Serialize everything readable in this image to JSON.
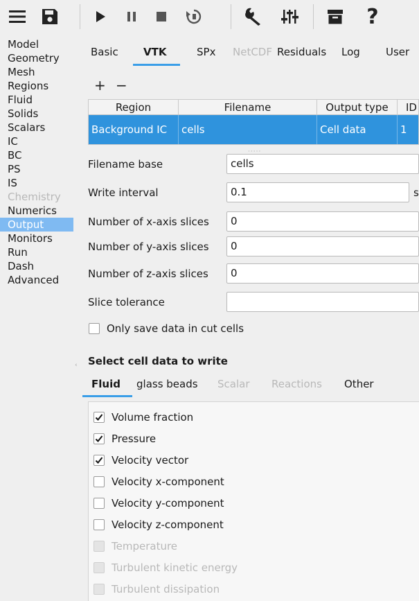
{
  "toolbar": {
    "buttons": [
      {
        "name": "menu-icon"
      },
      {
        "name": "save-icon"
      },
      {
        "name": "play-icon"
      },
      {
        "name": "pause-icon"
      },
      {
        "name": "stop-icon"
      },
      {
        "name": "reset-icon"
      },
      {
        "name": "wrench-icon"
      },
      {
        "name": "sliders-icon"
      },
      {
        "name": "archive-icon"
      },
      {
        "name": "help-icon"
      }
    ]
  },
  "nav": {
    "items": [
      {
        "label": "Model"
      },
      {
        "label": "Geometry"
      },
      {
        "label": "Mesh"
      },
      {
        "label": "Regions"
      },
      {
        "label": "Fluid"
      },
      {
        "label": "Solids"
      },
      {
        "label": "Scalars"
      },
      {
        "label": "IC"
      },
      {
        "label": "BC"
      },
      {
        "label": "PS"
      },
      {
        "label": "IS"
      },
      {
        "label": "Chemistry",
        "disabled": true
      },
      {
        "label": "Numerics"
      },
      {
        "label": "Output",
        "selected": true
      },
      {
        "label": "Monitors"
      },
      {
        "label": "Run"
      },
      {
        "label": "Dash"
      },
      {
        "label": "Advanced"
      }
    ]
  },
  "tabs": [
    {
      "label": "Basic"
    },
    {
      "label": "VTK",
      "active": true
    },
    {
      "label": "SPx"
    },
    {
      "label": "NetCDF",
      "disabled": true
    },
    {
      "label": "Residuals"
    },
    {
      "label": "Log"
    },
    {
      "label": "User"
    }
  ],
  "vtk_table": {
    "add_label": "+",
    "remove_label": "−",
    "columns": [
      "Region",
      "Filename",
      "Output type",
      "ID"
    ],
    "rows": [
      {
        "region": "Background IC",
        "filename": "cells",
        "output_type": "Cell data",
        "id": "1"
      }
    ]
  },
  "form": {
    "filename_base": {
      "label": "Filename base",
      "value": "cells"
    },
    "write_interval": {
      "label": "Write interval",
      "value": "0.1",
      "unit": "s"
    },
    "x_slices": {
      "label": "Number of x-axis slices",
      "value": "0"
    },
    "y_slices": {
      "label": "Number of y-axis slices",
      "value": "0"
    },
    "z_slices": {
      "label": "Number of z-axis slices",
      "value": "0"
    },
    "slice_tolerance": {
      "label": "Slice tolerance",
      "value": ""
    },
    "cut_cells": {
      "label": "Only save data in cut cells",
      "checked": false
    }
  },
  "cell_data": {
    "title": "Select cell data to write",
    "sub_tabs": [
      {
        "label": "Fluid",
        "active": true
      },
      {
        "label": "glass beads"
      },
      {
        "label": "Scalar",
        "disabled": true
      },
      {
        "label": "Reactions",
        "disabled": true
      },
      {
        "label": "Other"
      }
    ],
    "fields": [
      {
        "label": "Volume fraction",
        "checked": true
      },
      {
        "label": "Pressure",
        "checked": true
      },
      {
        "label": "Velocity vector",
        "checked": true
      },
      {
        "label": "Velocity x-component",
        "checked": false
      },
      {
        "label": "Velocity y-component",
        "checked": false
      },
      {
        "label": "Velocity z-component",
        "checked": false
      },
      {
        "label": "Temperature",
        "checked": false,
        "disabled": true
      },
      {
        "label": "Turbulent kinetic energy",
        "checked": false,
        "disabled": true
      },
      {
        "label": "Turbulent dissipation",
        "checked": false,
        "disabled": true
      }
    ]
  },
  "colors": {
    "accent": "#2f93dd",
    "nav_selected": "#7fbaf2",
    "tab_underline": "#3a9ee8"
  }
}
